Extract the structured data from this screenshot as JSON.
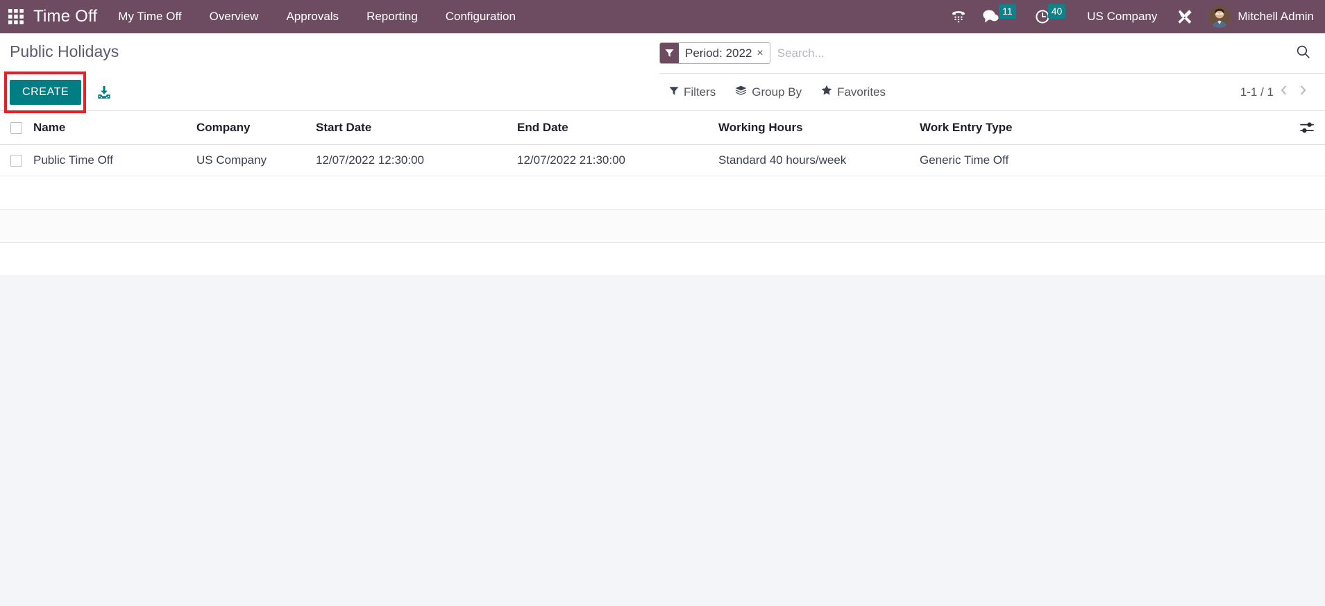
{
  "navbar": {
    "apps_icon": "apps-grid-icon",
    "brand": "Time Off",
    "menu": [
      {
        "label": "My Time Off"
      },
      {
        "label": "Overview"
      },
      {
        "label": "Approvals"
      },
      {
        "label": "Reporting"
      },
      {
        "label": "Configuration"
      }
    ],
    "systray": {
      "phone_icon": "phone-dialpad-icon",
      "messages_icon": "chat-bubble-icon",
      "messages_count": "11",
      "activities_icon": "clock-icon",
      "activities_count": "40",
      "company": "US Company",
      "tools_icon": "wrench-screwdriver-icon",
      "avatar": "user-avatar",
      "username": "Mitchell Admin"
    },
    "background_color": "#6d4c61",
    "badge_color": "#0e8189"
  },
  "control_panel": {
    "breadcrumb": "Public Holidays",
    "create_label": "CREATE",
    "create_color": "#017d84",
    "import_icon": "import-icon",
    "annotation_color": "#ee1c25",
    "search": {
      "facet": {
        "icon": "filter-funnel-icon",
        "label": "Period: 2022",
        "close": "×"
      },
      "placeholder": "Search...",
      "value": "",
      "magnifier_icon": "search-icon"
    },
    "buttons": [
      {
        "label": "Filters",
        "icon": "filter-funnel-icon"
      },
      {
        "label": "Group By",
        "icon": "layers-icon"
      },
      {
        "label": "Favorites",
        "icon": "star-icon"
      }
    ],
    "pager": {
      "count": "1-1 / 1",
      "prev_icon": "chevron-left-icon",
      "next_icon": "chevron-right-icon"
    }
  },
  "list": {
    "columns": [
      "Name",
      "Company",
      "Start Date",
      "End Date",
      "Working Hours",
      "Work Entry Type"
    ],
    "optional_columns_icon": "sliders-icon",
    "rows": [
      {
        "name": "Public Time Off",
        "company": "US Company",
        "start_date": "12/07/2022 12:30:00",
        "end_date": "12/07/2022 21:30:00",
        "working_hours": "Standard 40 hours/week",
        "work_entry_type": "Generic Time Off"
      }
    ]
  }
}
